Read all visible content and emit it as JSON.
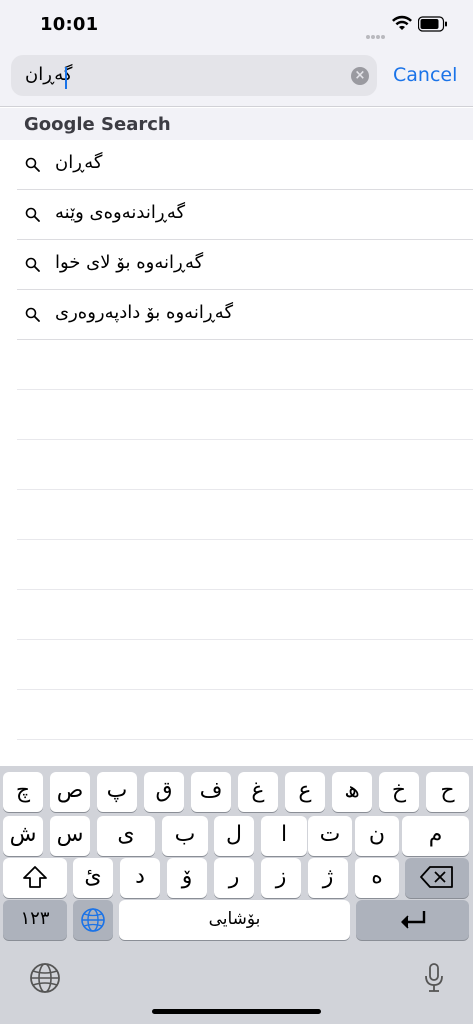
{
  "status_bar": {
    "time": "10:01"
  },
  "search": {
    "value": "گەڕان",
    "cancel_label": "Cancel"
  },
  "section_title": "Google Search",
  "suggestions": [
    "گەڕان",
    "گەڕاندنەوەی وێنە",
    "گەڕانەوە بۆ لای خوا",
    "گەڕانەوە بۆ دادپەروەری"
  ],
  "keyboard": {
    "row1": [
      "چ",
      "ص",
      "پ",
      "ق",
      "ف",
      "غ",
      "ع",
      "ھ",
      "خ",
      "ح"
    ],
    "row2": [
      "ش",
      "س",
      "ی",
      "ب",
      "ل",
      "ا",
      "ت",
      "ن",
      "م"
    ],
    "row3": [
      "ئ",
      "د",
      "ۆ",
      "ر",
      "ز",
      "ژ",
      "ە"
    ],
    "numbers_label": "١٢٣",
    "space_label": "بۆشایی"
  },
  "icons": {
    "accent": "#1a73e8"
  }
}
